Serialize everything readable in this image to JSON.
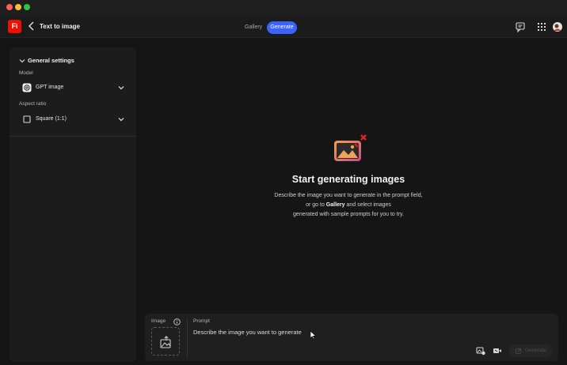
{
  "app": {
    "logo_text": "Fi",
    "page_title": "Text to image",
    "tabs": {
      "gallery": "Gallery",
      "generate": "Generate"
    },
    "accent_color": "#3b63fb",
    "brand_color": "#eb1000"
  },
  "sidebar": {
    "section_title": "General settings",
    "model": {
      "label": "Model",
      "value": "GPT image",
      "icon": "gpt-logo-icon"
    },
    "aspect_ratio": {
      "label": "Aspect ratio",
      "value": "Square (1:1)",
      "icon": "square-icon"
    }
  },
  "empty_state": {
    "title": "Start generating images",
    "line1": "Describe the image you want to generate in the prompt field,",
    "line2_prefix": "or go to ",
    "line2_link": "Gallery",
    "line2_suffix": " and select images",
    "line3": "generated with sample prompts for you to try."
  },
  "prompt_panel": {
    "image_label": "Image",
    "prompt_label": "Prompt",
    "prompt_placeholder": "Describe the image you want to generate",
    "generate_label": "Generate"
  }
}
